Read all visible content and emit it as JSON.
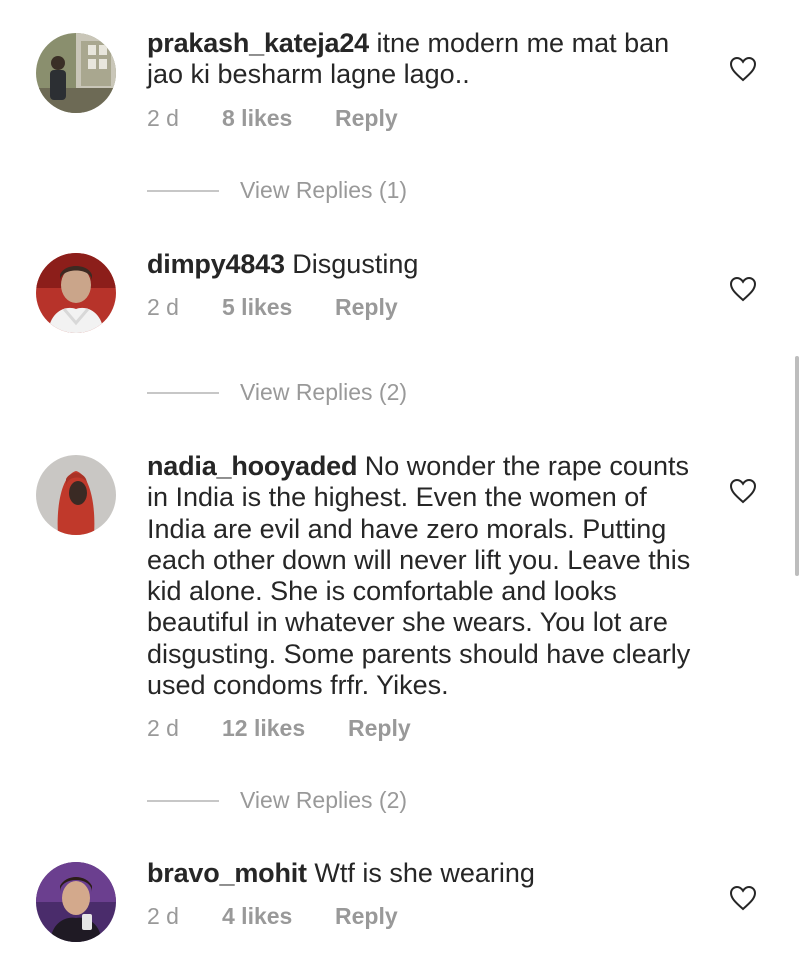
{
  "comments": [
    {
      "username": "prakash_kateja24",
      "text": "itne modern me mat ban jao ki besharm lagne lago..",
      "time": "2 d",
      "likes": "8 likes",
      "reply": "Reply",
      "view_replies": "View Replies (1)",
      "avatar": "profile-photo-man-standing"
    },
    {
      "username": "dimpy4843",
      "text": "Disgusting",
      "time": "2 d",
      "likes": "5 likes",
      "reply": "Reply",
      "view_replies": "View Replies (2)",
      "avatar": "profile-photo-woman-white-scarf"
    },
    {
      "username": "nadia_hooyaded",
      "text": "No wonder the rape counts in India is the highest. Even the women of India are evil and have zero morals. Putting each other down will never lift you. Leave this kid alone. She is comfortable and looks beautiful in whatever she wears. You lot are disgusting. Some parents should have clearly used condoms frfr. Yikes.",
      "time": "2 d",
      "likes": "12 likes",
      "reply": "Reply",
      "view_replies": "View Replies (2)",
      "avatar": "profile-photo-person-red-hood"
    },
    {
      "username": "bravo_mohit",
      "text": "Wtf is she wearing",
      "time": "2 d",
      "likes": "4 likes",
      "reply": "Reply",
      "avatar": "profile-photo-man-selfie"
    }
  ],
  "icons": {
    "like": "heart-outline-icon"
  },
  "colors": {
    "text": "#262626",
    "secondary": "#999999",
    "divider": "#c7c7c7",
    "background": "#ffffff"
  }
}
